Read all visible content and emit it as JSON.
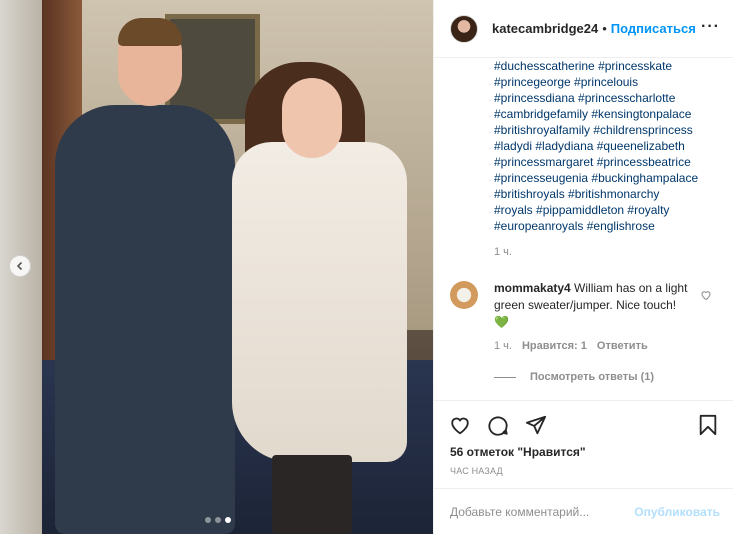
{
  "post": {
    "author": "katecambridge24",
    "separator": "•",
    "follow_label": "Подписаться",
    "more_label": "···"
  },
  "caption": {
    "hashtags": [
      "#duchesscatherine #princesskate",
      "#princegeorge #princelouis",
      "#princessdiana #princesscharlotte",
      "#cambridgefamily #kensingtonpalace",
      "#britishroyalfamily #childrensprincess",
      "#ladydi #ladydiana #queenelizabeth",
      "#princessmargaret #princessbeatrice",
      "#princesseugenia #buckinghampalace",
      "#britishroyals #britishmonarchy",
      "#royals #pippamiddleton #royalty",
      "#europeanroyals #englishrose"
    ],
    "time": "1 ч."
  },
  "comment": {
    "user": "mommakaty4",
    "text": " William has on a light green sweater/jumper. Nice touch! ",
    "emoji": "💚",
    "time": "1 ч.",
    "likes": "Нравится: 1",
    "reply_label": "Ответить",
    "view_replies": "Посмотреть ответы (1)"
  },
  "actions": {
    "likes_count": "56 отметок \"Нравится\"",
    "posted_ago": "ЧАС НАЗАД"
  },
  "add_comment": {
    "placeholder": "Добавьте комментарий...",
    "publish_label": "Опубликовать"
  },
  "carousel": {
    "slide_count": 3,
    "active_slide": 3
  },
  "icons": [
    "chevron-left-icon",
    "heart-icon",
    "comment-icon",
    "share-icon",
    "bookmark-icon",
    "like-comment-icon"
  ],
  "colors": {
    "link": "#00376b",
    "follow": "#0095f6",
    "muted": "#8e8e8e",
    "publish_disabled": "#b2dffc"
  }
}
